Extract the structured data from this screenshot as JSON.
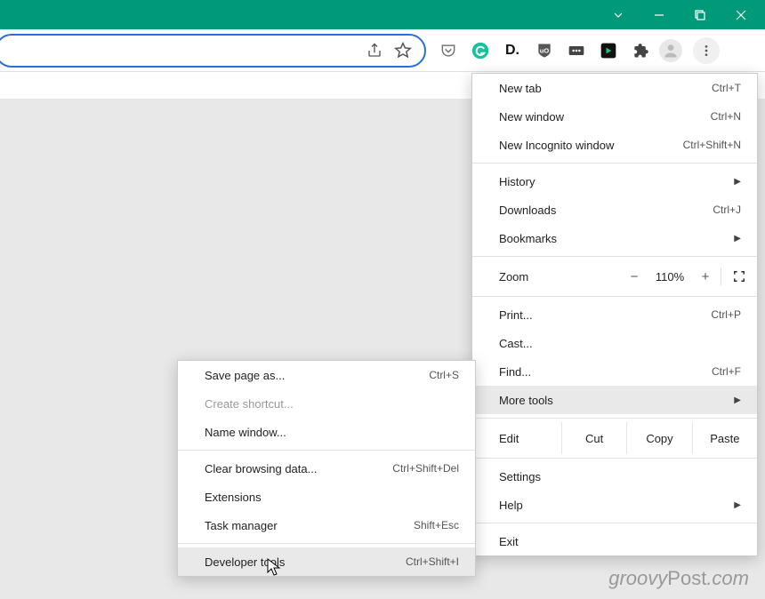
{
  "menu": {
    "new_tab": {
      "label": "New tab",
      "shortcut": "Ctrl+T"
    },
    "new_window": {
      "label": "New window",
      "shortcut": "Ctrl+N"
    },
    "new_incognito": {
      "label": "New Incognito window",
      "shortcut": "Ctrl+Shift+N"
    },
    "history": {
      "label": "History"
    },
    "downloads": {
      "label": "Downloads",
      "shortcut": "Ctrl+J"
    },
    "bookmarks": {
      "label": "Bookmarks"
    },
    "zoom": {
      "label": "Zoom",
      "value": "110%"
    },
    "print": {
      "label": "Print...",
      "shortcut": "Ctrl+P"
    },
    "cast": {
      "label": "Cast..."
    },
    "find": {
      "label": "Find...",
      "shortcut": "Ctrl+F"
    },
    "more_tools": {
      "label": "More tools"
    },
    "edit": {
      "label": "Edit",
      "cut": "Cut",
      "copy": "Copy",
      "paste": "Paste"
    },
    "settings": {
      "label": "Settings"
    },
    "help": {
      "label": "Help"
    },
    "exit": {
      "label": "Exit"
    }
  },
  "submenu": {
    "save_page": {
      "label": "Save page as...",
      "shortcut": "Ctrl+S"
    },
    "create_shortcut": {
      "label": "Create shortcut..."
    },
    "name_window": {
      "label": "Name window..."
    },
    "clear_data": {
      "label": "Clear browsing data...",
      "shortcut": "Ctrl+Shift+Del"
    },
    "extensions": {
      "label": "Extensions"
    },
    "task_manager": {
      "label": "Task manager",
      "shortcut": "Shift+Esc"
    },
    "dev_tools": {
      "label": "Developer tools",
      "shortcut": "Ctrl+Shift+I"
    }
  },
  "watermark": {
    "a": "groovy",
    "b": "Post",
    "c": ".com"
  }
}
